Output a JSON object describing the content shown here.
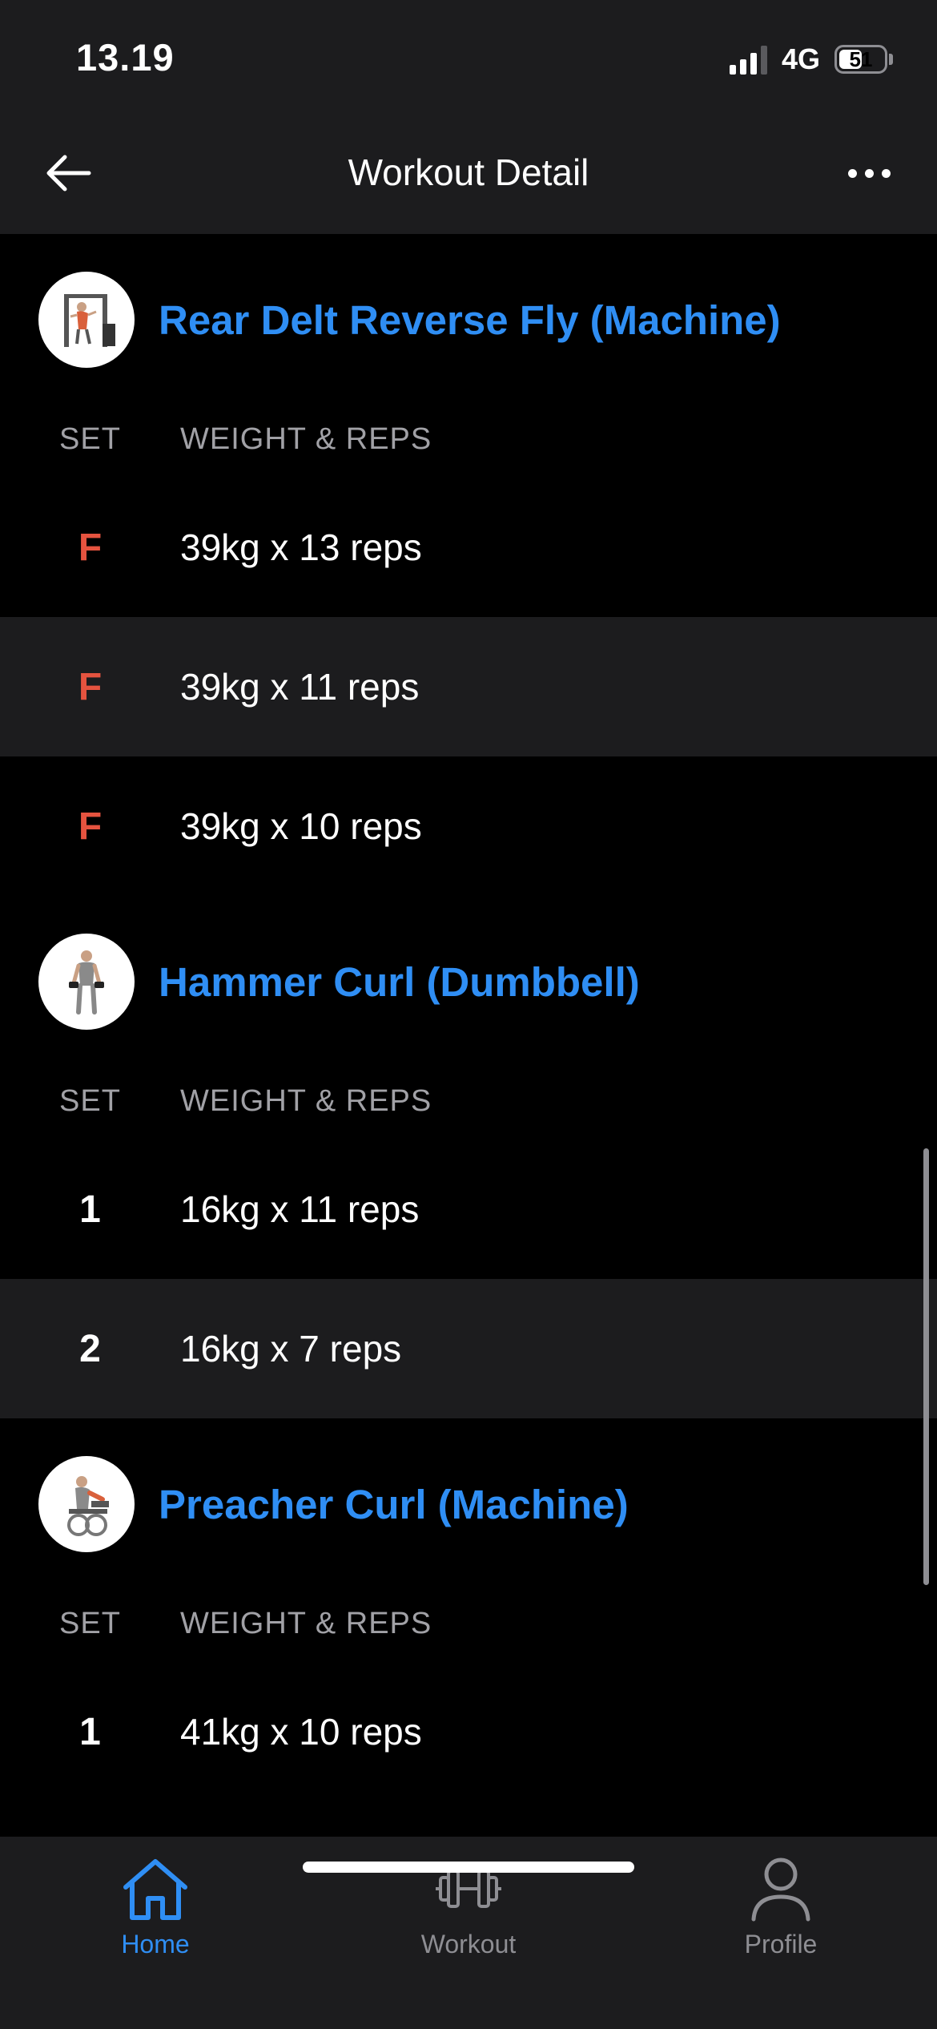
{
  "status_bar": {
    "time": "13.19",
    "network": "4G",
    "battery": "51",
    "battery_level": 0.51
  },
  "header": {
    "title": "Workout Detail",
    "back_icon": "arrow-left-icon",
    "more_icon": "ellipsis-icon"
  },
  "columns": {
    "set": "SET",
    "weight_reps": "WEIGHT & REPS"
  },
  "colors": {
    "accent": "#2f8ef4",
    "failure": "#e5533f",
    "background": "#000000",
    "surface": "#1c1c1e"
  },
  "exercises": [
    {
      "name": "Rear Delt Reverse Fly (Machine)",
      "thumb_icon": "machine-exercise-illustration",
      "sets": [
        {
          "label": "F",
          "value": "39kg x 13 reps"
        },
        {
          "label": "F",
          "value": "39kg x 11 reps"
        },
        {
          "label": "F",
          "value": "39kg x 10 reps"
        }
      ]
    },
    {
      "name": "Hammer Curl (Dumbbell)",
      "thumb_icon": "dumbbell-exercise-illustration",
      "sets": [
        {
          "label": "1",
          "value": "16kg x 11 reps"
        },
        {
          "label": "2",
          "value": "16kg x 7 reps"
        }
      ]
    },
    {
      "name": "Preacher Curl (Machine)",
      "thumb_icon": "machine-exercise-illustration",
      "sets": [
        {
          "label": "1",
          "value": "41kg x 10 reps"
        }
      ]
    }
  ],
  "tab_bar": {
    "tabs": [
      {
        "label": "Home",
        "icon": "home-icon",
        "active": true
      },
      {
        "label": "Workout",
        "icon": "dumbbell-icon",
        "active": false
      },
      {
        "label": "Profile",
        "icon": "person-icon",
        "active": false
      }
    ]
  }
}
